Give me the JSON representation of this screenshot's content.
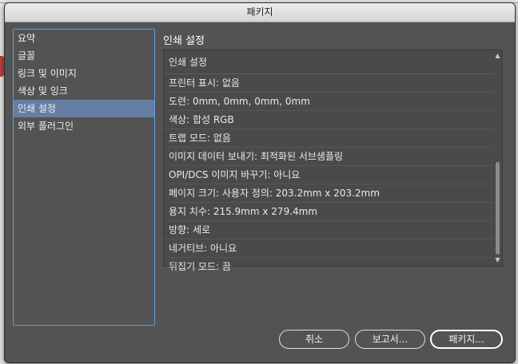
{
  "dialog": {
    "title": "패키지"
  },
  "sidebar": {
    "items": [
      {
        "label": "요약"
      },
      {
        "label": "글꼴"
      },
      {
        "label": "링크 및 이미지"
      },
      {
        "label": "색상 및 잉크"
      },
      {
        "label": "인쇄 설정",
        "selected": true
      },
      {
        "label": "외부 플러그인"
      }
    ]
  },
  "panel": {
    "title": "인쇄 설정",
    "header": "인쇄 설정",
    "rows": [
      "프린터 표시: 없음",
      "도련: 0mm, 0mm, 0mm, 0mm",
      "색상: 합성 RGB",
      "트랩 모드: 없음",
      "이미지 데이터 보내기: 최적화된 서브샘플링",
      "OPI/DCS 이미지 바꾸기: 아니요",
      "페이지 크기: 사용자 정의: 203.2mm x 203.2mm",
      "용지 치수: 215.9mm x 279.4mm",
      "방향: 세로",
      "네거티브: 아니요",
      "뒤집기 모드: 끔"
    ]
  },
  "buttons": {
    "cancel": "취소",
    "report": "보고서...",
    "package": "패키지..."
  },
  "icons": {
    "scroll_up": "chevron-up-icon",
    "scroll_down": "chevron-down-icon"
  },
  "colors": {
    "dialog_bg": "#535353",
    "selection": "#677ea3",
    "focus_ring": "#5a9ee8"
  }
}
